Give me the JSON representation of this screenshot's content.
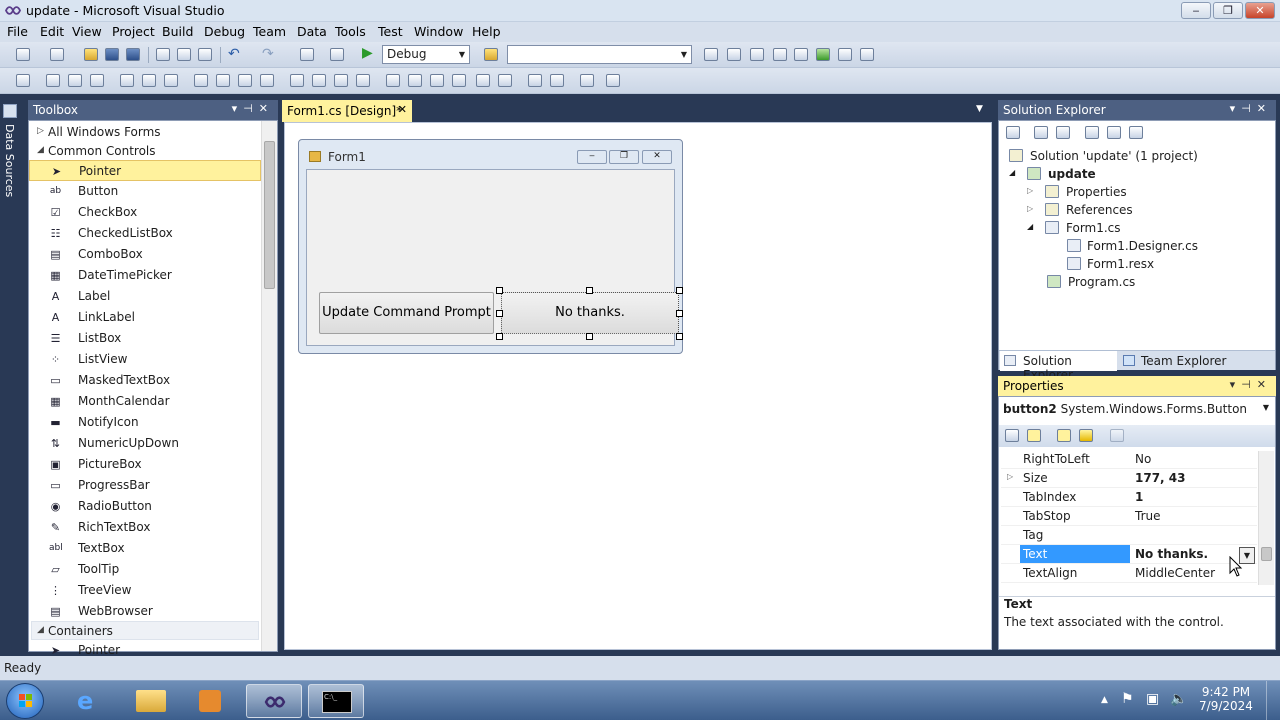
{
  "window": {
    "title": "update - Microsoft Visual Studio",
    "min": "▭",
    "max": "◻",
    "close": "✕"
  },
  "menu": [
    "File",
    "Edit",
    "View",
    "Project",
    "Build",
    "Debug",
    "Team",
    "Data",
    "Tools",
    "Test",
    "Window",
    "Help"
  ],
  "toolbar": {
    "config": "Debug",
    "platform": ""
  },
  "side_strip": {
    "label": "Data Sources"
  },
  "toolbox": {
    "title": "Toolbox",
    "all_forms": "All Windows Forms",
    "common": "Common Controls",
    "items": [
      {
        "label": "Pointer",
        "icon": "pointer-icon",
        "glyph": "➤"
      },
      {
        "label": "Button",
        "icon": "button-icon",
        "glyph": "ab"
      },
      {
        "label": "CheckBox",
        "icon": "checkbox-icon",
        "glyph": "☑"
      },
      {
        "label": "CheckedListBox",
        "icon": "checkedlistbox-icon",
        "glyph": "☷"
      },
      {
        "label": "ComboBox",
        "icon": "combobox-icon",
        "glyph": "▤"
      },
      {
        "label": "DateTimePicker",
        "icon": "datetimepicker-icon",
        "glyph": "▦"
      },
      {
        "label": "Label",
        "icon": "label-icon",
        "glyph": "A"
      },
      {
        "label": "LinkLabel",
        "icon": "linklabel-icon",
        "glyph": "A"
      },
      {
        "label": "ListBox",
        "icon": "listbox-icon",
        "glyph": "☰"
      },
      {
        "label": "ListView",
        "icon": "listview-icon",
        "glyph": "⁘"
      },
      {
        "label": "MaskedTextBox",
        "icon": "maskedtextbox-icon",
        "glyph": "▭"
      },
      {
        "label": "MonthCalendar",
        "icon": "monthcalendar-icon",
        "glyph": "▦"
      },
      {
        "label": "NotifyIcon",
        "icon": "notifyicon-icon",
        "glyph": "▬"
      },
      {
        "label": "NumericUpDown",
        "icon": "numericupdown-icon",
        "glyph": "⇅"
      },
      {
        "label": "PictureBox",
        "icon": "picturebox-icon",
        "glyph": "▣"
      },
      {
        "label": "ProgressBar",
        "icon": "progressbar-icon",
        "glyph": "▭"
      },
      {
        "label": "RadioButton",
        "icon": "radiobutton-icon",
        "glyph": "◉"
      },
      {
        "label": "RichTextBox",
        "icon": "richtextbox-icon",
        "glyph": "✎"
      },
      {
        "label": "TextBox",
        "icon": "textbox-icon",
        "glyph": "abl"
      },
      {
        "label": "ToolTip",
        "icon": "tooltip-icon",
        "glyph": "▱"
      },
      {
        "label": "TreeView",
        "icon": "treeview-icon",
        "glyph": "⋮"
      },
      {
        "label": "WebBrowser",
        "icon": "webbrowser-icon",
        "glyph": "▤"
      }
    ],
    "containers": "Containers",
    "containers_pointer": "Pointer"
  },
  "designer": {
    "tab": "Form1.cs [Design]*",
    "form_title": "Form1",
    "button1": "Update Command Prompt",
    "button2": "No thanks."
  },
  "solution_explorer": {
    "title": "Solution Explorer",
    "solution": "Solution 'update' (1 project)",
    "project": "update",
    "properties": "Properties",
    "references": "References",
    "form1": "Form1.cs",
    "designer": "Form1.Designer.cs",
    "resx": "Form1.resx",
    "program": "Program.cs",
    "tab1": "Solution Explorer",
    "tab2": "Team Explorer"
  },
  "properties": {
    "title": "Properties",
    "object_name": "button2",
    "object_type": "System.Windows.Forms.Button",
    "rows": [
      {
        "name": "RightToLeft",
        "value": "No",
        "bold": false
      },
      {
        "name": "Size",
        "value": "177, 43",
        "bold": true
      },
      {
        "name": "TabIndex",
        "value": "1",
        "bold": true
      },
      {
        "name": "TabStop",
        "value": "True",
        "bold": false
      },
      {
        "name": "Tag",
        "value": "",
        "bold": false
      },
      {
        "name": "Text",
        "value": "No thanks.",
        "bold": true
      },
      {
        "name": "TextAlign",
        "value": "MiddleCenter",
        "bold": false
      }
    ],
    "desc_title": "Text",
    "desc_text": "The text associated with the control."
  },
  "status": "Ready",
  "clock": {
    "time": "9:42 PM",
    "date": "7/9/2024"
  }
}
